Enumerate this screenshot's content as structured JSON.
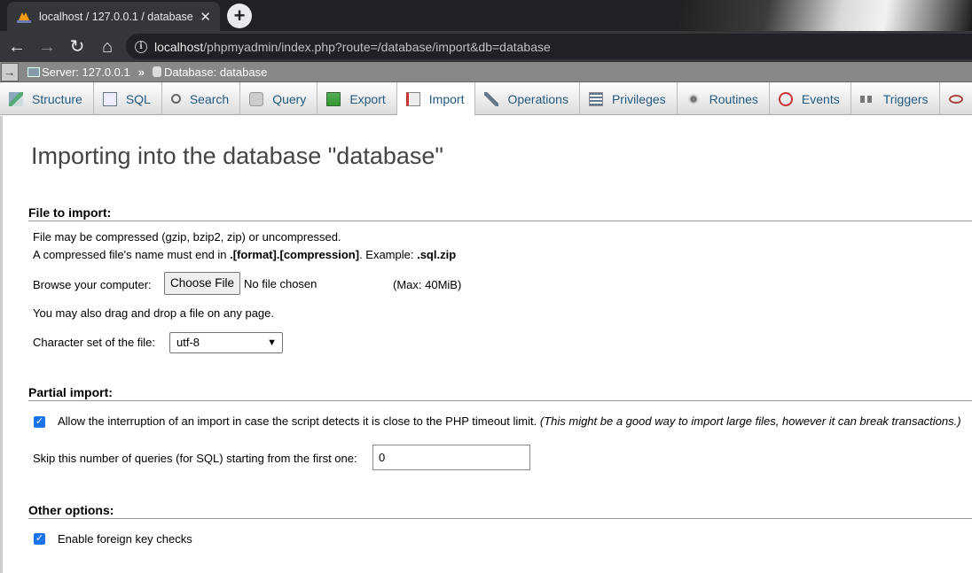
{
  "browser": {
    "tab_title": "localhost / 127.0.0.1 / database |",
    "url_host": "localhost",
    "url_path": "/phpmyadmin/index.php?route=/database/import&db=database"
  },
  "breadcrumb": {
    "arrow": "→",
    "server": "Server: 127.0.0.1",
    "separator": "»",
    "database": "Database: database"
  },
  "tabs": [
    {
      "label": "Structure",
      "icon": "structure-icon"
    },
    {
      "label": "SQL",
      "icon": "sql-icon"
    },
    {
      "label": "Search",
      "icon": "search-icon"
    },
    {
      "label": "Query",
      "icon": "query-icon"
    },
    {
      "label": "Export",
      "icon": "export-icon"
    },
    {
      "label": "Import",
      "icon": "import-icon",
      "active": true
    },
    {
      "label": "Operations",
      "icon": "wrench-icon"
    },
    {
      "label": "Privileges",
      "icon": "privileges-icon"
    },
    {
      "label": "Routines",
      "icon": "routines-icon"
    },
    {
      "label": "Events",
      "icon": "clock-icon"
    },
    {
      "label": "Triggers",
      "icon": "triggers-icon"
    }
  ],
  "main": {
    "title": "Importing into the database \"database\"",
    "file_section": {
      "heading": "File to import:",
      "compress_note": "File may be compressed (gzip, bzip2, zip) or uncompressed.",
      "name_note_pre": "A compressed file's name must end in ",
      "name_note_format": ".[format].[compression]",
      "name_note_mid": ". Example: ",
      "name_note_example": ".sql.zip",
      "browse_label": "Browse your computer:",
      "choose_button": "Choose File",
      "no_file": "No file chosen",
      "max_size": "(Max: 40MiB)",
      "drag_note": "You may also drag and drop a file on any page.",
      "charset_label": "Character set of the file:",
      "charset_value": "utf-8"
    },
    "partial_section": {
      "heading": "Partial import:",
      "allow_interrupt": "Allow the interruption of an import in case the script detects it is close to the PHP timeout limit.",
      "allow_interrupt_note": "(This might be a good way to import large files, however it can break transactions.)",
      "allow_interrupt_checked": true,
      "skip_label": "Skip this number of queries (for SQL) starting from the first one:",
      "skip_value": "0"
    },
    "other_section": {
      "heading": "Other options:",
      "foreign_key_label": "Enable foreign key checks",
      "foreign_key_checked": true
    }
  }
}
